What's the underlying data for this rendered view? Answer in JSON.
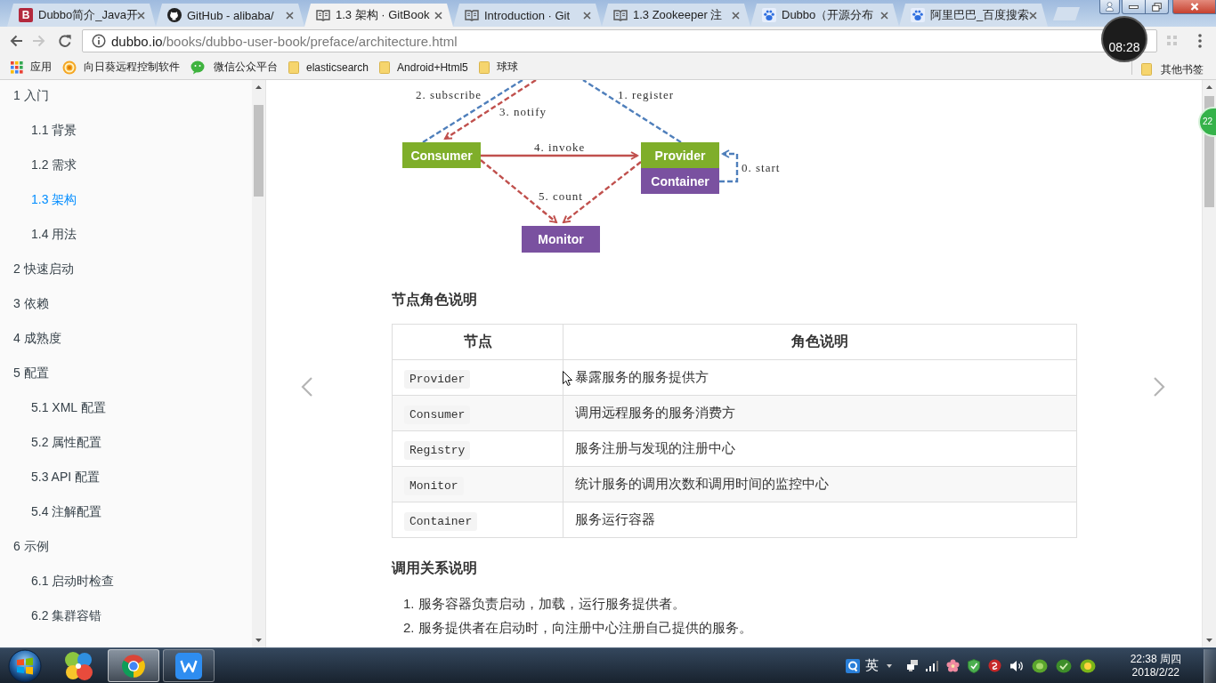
{
  "tabs": [
    {
      "kind": "letter",
      "badge": "B",
      "title": "Dubbo简介_Java开",
      "selected": false
    },
    {
      "kind": "github",
      "title": "GitHub - alibaba/",
      "selected": false
    },
    {
      "kind": "book",
      "title": "1.3 架构 · GitBook",
      "selected": true
    },
    {
      "kind": "book",
      "title": "Introduction · Git",
      "selected": false
    },
    {
      "kind": "book",
      "title": "1.3 Zookeeper 注",
      "selected": false
    },
    {
      "kind": "paw",
      "title": "Dubbo（开源分布",
      "selected": false
    },
    {
      "kind": "paw",
      "title": "阿里巴巴_百度搜索",
      "selected": false
    }
  ],
  "toolbar": {
    "forward": {
      "disabled": true
    },
    "url_host": "dubbo.io",
    "url_path": "/books/dubbo-user-book/preface/architecture.html"
  },
  "bookmarks": {
    "items": [
      {
        "kind": "apps",
        "label": "应用"
      },
      {
        "kind": "sunflower",
        "label": "向日葵远程控制软件"
      },
      {
        "kind": "chat",
        "label": "微信公众平台"
      },
      {
        "kind": "folder",
        "label": "elasticsearch"
      },
      {
        "kind": "folder",
        "label": "Android+Html5"
      },
      {
        "kind": "folder",
        "label": "球球"
      }
    ],
    "other": {
      "kind": "folder",
      "label": "其他书签"
    }
  },
  "sidebar": {
    "items": [
      {
        "label": "1 入门",
        "selected": false,
        "children": [
          {
            "label": "1.1 背景",
            "selected": false
          },
          {
            "label": "1.2 需求",
            "selected": false
          },
          {
            "label": "1.3 架构",
            "selected": true
          },
          {
            "label": "1.4 用法",
            "selected": false
          }
        ]
      },
      {
        "label": "2 快速启动",
        "selected": false
      },
      {
        "label": "3 依赖",
        "selected": false
      },
      {
        "label": "4 成熟度",
        "selected": false
      },
      {
        "label": "5 配置",
        "selected": false,
        "children": [
          {
            "label": "5.1 XML 配置",
            "selected": false
          },
          {
            "label": "5.2 属性配置",
            "selected": false
          },
          {
            "label": "5.3 API 配置",
            "selected": false
          },
          {
            "label": "5.4 注解配置",
            "selected": false
          }
        ]
      },
      {
        "label": "6 示例",
        "selected": false,
        "children": [
          {
            "label": "6.1 启动时检查",
            "selected": false
          },
          {
            "label": "6.2 集群容错",
            "selected": false
          }
        ]
      }
    ]
  },
  "article": {
    "diagram": {
      "nodes": [
        {
          "label": "Consumer",
          "color": "#7fae2a"
        },
        {
          "label": "Provider",
          "color": "#7fae2a"
        },
        {
          "label": "Container",
          "color": "#7a51a0"
        },
        {
          "label": "Monitor",
          "color": "#7a51a0"
        }
      ],
      "edges": [
        {
          "label": "2. subscribe",
          "kind": "dashed",
          "color": "#4f7fbb"
        },
        {
          "label": "1. register",
          "kind": "dashed",
          "color": "#4f7fbb"
        },
        {
          "label": "3. notify",
          "kind": "dashed",
          "color": "#c0504d"
        },
        {
          "label": "4. invoke",
          "kind": "solid",
          "color": "#c0504d"
        },
        {
          "label": "0. start",
          "kind": "dashed",
          "color": "#4f7fbb"
        },
        {
          "label": "5. count",
          "kind": "dashed",
          "color": "#c0504d"
        }
      ]
    },
    "roles_heading": "节点角色说明",
    "table": {
      "columns": [
        "节点",
        "角色说明"
      ],
      "rows": [
        {
          "node": "Provider",
          "role": "暴露服务的服务提供方"
        },
        {
          "node": "Consumer",
          "role": "调用远程服务的服务消费方"
        },
        {
          "node": "Registry",
          "role": "服务注册与发现的注册中心"
        },
        {
          "node": "Monitor",
          "role": "统计服务的调用次数和调用时间的监控中心"
        },
        {
          "node": "Container",
          "role": "服务运行容器"
        }
      ]
    },
    "calls_heading": "调用关系说明",
    "calls": [
      {
        "number": "1.",
        "text": "服务容器负责启动，加载，运行服务提供者。"
      },
      {
        "number": "2.",
        "text": "服务提供者在启动时，向注册中心注册自己提供的服务。"
      }
    ]
  },
  "taskbar": {
    "apps": [
      {
        "kind": "clover",
        "running": false,
        "selected": false
      },
      {
        "kind": "browser",
        "running": true,
        "selected": true
      },
      {
        "kind": "tile",
        "running": true,
        "selected": false
      }
    ],
    "tray": {
      "ime": "英",
      "time": "22:38 周四",
      "date": "2018/2/22"
    }
  },
  "recording_timer": "08:28",
  "floating_ball": "22"
}
